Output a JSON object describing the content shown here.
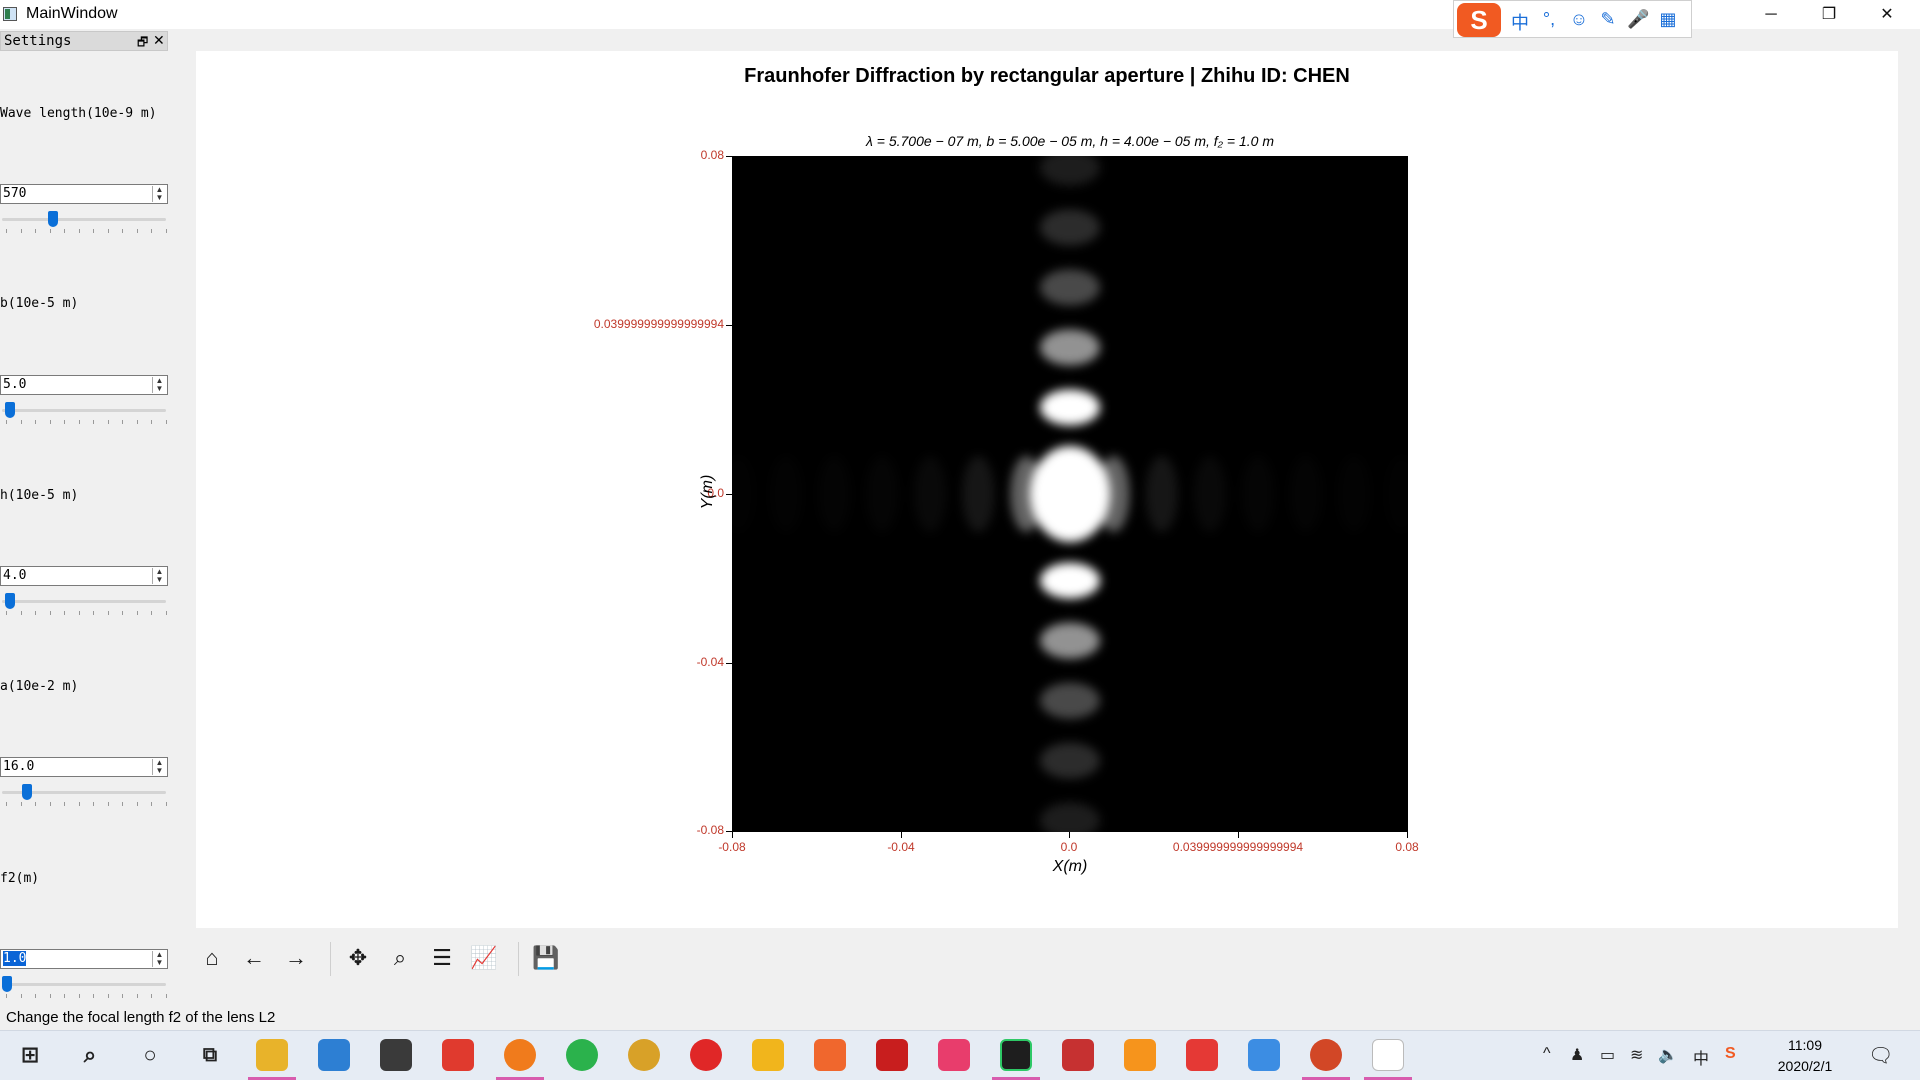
{
  "window": {
    "title": "MainWindow",
    "minimize_glyph": "─",
    "maximize_glyph": "❐",
    "close_glyph": "✕"
  },
  "ime_toolbar": {
    "logo": "S",
    "items": [
      "中",
      "°,",
      "☺",
      "✎",
      "🎤",
      "▦"
    ]
  },
  "dock": {
    "title": "Settings",
    "float_glyph": "🗗",
    "close_glyph": "✕",
    "params": [
      {
        "label": "Wave length(10e-9 m)",
        "value": "570",
        "slider_fraction": 0.3
      },
      {
        "label": "b(10e-5 m)",
        "value": "5.0",
        "slider_fraction": 0.02
      },
      {
        "label": "h(10e-5 m)",
        "value": "4.0",
        "slider_fraction": 0.02
      },
      {
        "label": "a(10e-2 m)",
        "value": "16.0",
        "slider_fraction": 0.13
      },
      {
        "label": "f2(m)",
        "value": "1.0",
        "slider_fraction": 0.0
      }
    ]
  },
  "figure": {
    "title": "Fraunhofer Diffraction by rectangular aperture | Zhihu ID: CHEN",
    "subtitle": "λ = 5.700e − 07 m,  b = 5.00e − 05 m,  h = 4.00e − 05 m,  f₂ = 1.0 m",
    "xlabel": "X(m)",
    "ylabel": "Y(m)",
    "xticks": [
      "-0.08",
      "-0.04",
      "0.0",
      "0.039999999999999994",
      "0.08"
    ],
    "yticks": [
      "0.08",
      "0.039999999999999994",
      "0.0",
      "-0.04",
      "-0.08"
    ]
  },
  "chart_data": {
    "type": "heatmap",
    "title": "Fraunhofer Diffraction by rectangular aperture | Zhihu ID: CHEN",
    "subtitle": "λ = 5.700e − 07 m,  b = 5.00e − 05 m,  h = 4.00e − 05 m,  f₂ = 1.0 m",
    "xlabel": "X(m)",
    "ylabel": "Y(m)",
    "xlim": [
      -0.08,
      0.08
    ],
    "ylim": [
      -0.08,
      0.08
    ],
    "wavelength_m": 5.7e-07,
    "b_m": 5e-05,
    "h_m": 4e-05,
    "f2_m": 1.0,
    "colormap": "gray",
    "x_maxima_m": [
      -0.0785,
      -0.0672,
      -0.0558,
      -0.0445,
      -0.0331,
      -0.0217,
      -0.0103,
      0.0,
      0.0103,
      0.0217,
      0.0331,
      0.0445,
      0.0558,
      0.0672,
      0.0785
    ],
    "y_maxima_m": [
      -0.0773,
      -0.0631,
      -0.0489,
      -0.0347,
      -0.0205,
      0.0,
      0.0205,
      0.0347,
      0.0489,
      0.0631,
      0.0773
    ]
  },
  "toolbar": {
    "tools": [
      {
        "name": "home",
        "glyph": "⌂"
      },
      {
        "name": "back",
        "glyph": "←"
      },
      {
        "name": "forward",
        "glyph": "→"
      },
      {
        "name": "pan",
        "glyph": "✥"
      },
      {
        "name": "zoom",
        "glyph": "⌕"
      },
      {
        "name": "subplots",
        "glyph": "☰"
      },
      {
        "name": "edit-axes",
        "glyph": "📈"
      },
      {
        "name": "save",
        "glyph": "💾"
      }
    ]
  },
  "status": {
    "text": "Change the focal length f2 of the lens L2"
  },
  "taskbar": {
    "time": "11:09",
    "date": "2020/2/1",
    "ime_indicator": "中"
  }
}
